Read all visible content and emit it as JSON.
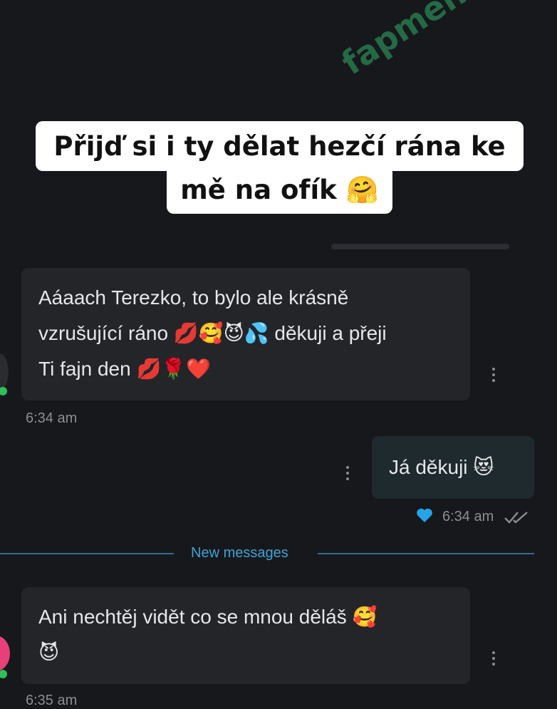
{
  "caption": {
    "line1": "Přijď si i ty dělat hezčí rána ke",
    "line2": "mě na ofík 🤗"
  },
  "watermark": "fapmenu.com",
  "messages": [
    {
      "direction": "incoming",
      "lines": [
        "Aáaach Terezko, to bylo ale krásně",
        "vzrušující ráno 💋🥰😈💦 děkuji a přeji",
        "Ti fajn den 💋🌹❤️"
      ],
      "time": "6:34 am"
    },
    {
      "direction": "outgoing",
      "lines": [
        "Já děkuji 😻"
      ],
      "time": "6:34 am",
      "liked": true,
      "read": true
    },
    {
      "direction": "incoming",
      "lines": [
        "Ani nechtěj vidět co se mnou děláš 🥰",
        "😈"
      ],
      "time": "6:35 am"
    }
  ],
  "divider_label": "New messages",
  "colors": {
    "background": "#17181c",
    "incoming_bubble": "#232529",
    "outgoing_bubble": "#1f2a2e",
    "accent": "#3fa3d6",
    "heart": "#26a4e8",
    "online": "#2fc05a"
  }
}
